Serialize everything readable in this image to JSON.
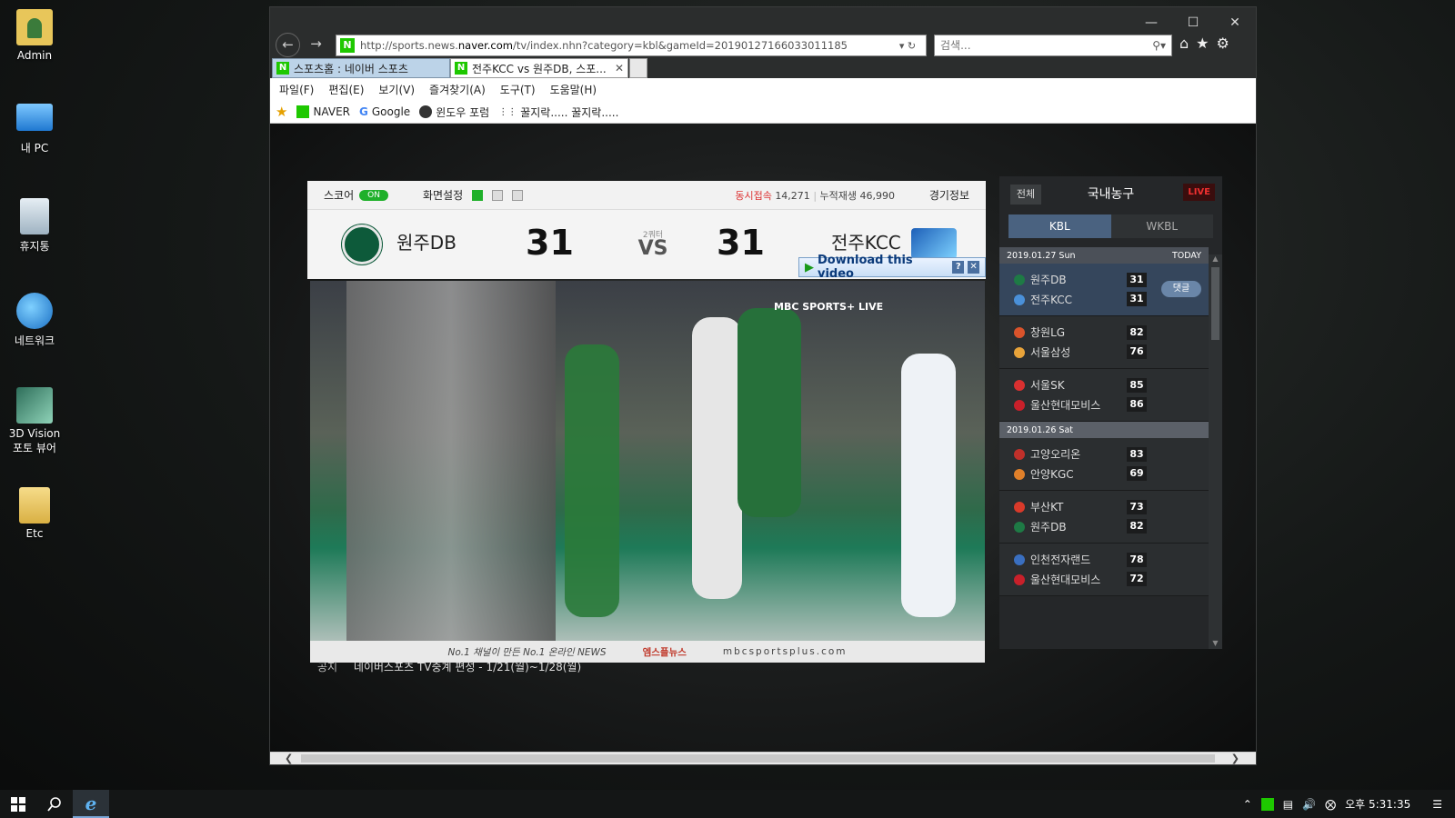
{
  "desktop": {
    "icons": [
      {
        "label": "Admin"
      },
      {
        "label": "내 PC"
      },
      {
        "label": "휴지통"
      },
      {
        "label": "네트워크"
      },
      {
        "label": "3D Vision 포토 뷰어"
      },
      {
        "label": "Etc"
      }
    ]
  },
  "taskbar": {
    "clock": "오후 5:31:35"
  },
  "browser": {
    "url_host_prefix": "http://sports.news.",
    "url_host": "naver.com",
    "url_path": "/tv/index.nhn?category=kbl&gameId=20190127166033011185",
    "search_placeholder": "검색...",
    "tabs": [
      {
        "label": "스포츠홈 : 네이버 스포츠"
      },
      {
        "label": "전주KCC vs 원주DB, 스포..."
      }
    ],
    "menu": [
      "파일(F)",
      "편집(E)",
      "보기(V)",
      "즐겨찾기(A)",
      "도구(T)",
      "도움말(H)"
    ],
    "favorites": [
      "NAVER",
      "Google",
      "윈도우 포럼",
      "꿀지락..... 꿀지락....."
    ]
  },
  "player": {
    "score_label": "스코어",
    "score_toggle": "ON",
    "screen_settings": "화면설정",
    "concurrent_label": "동시접속",
    "concurrent_value": "14,271",
    "cumulative_label": "누적재생",
    "cumulative_value": "46,990",
    "game_info": "경기정보",
    "home_team": "원주DB",
    "home_score": "31",
    "away_team": "전주KCC",
    "away_score": "31",
    "quarter": "2쿼터",
    "vs": "VS",
    "download_label": "Download this video",
    "video_caption_left": "No.1 채널이 만든 No.1 온라인 NEWS",
    "video_caption_brand": "엠스플뉴스",
    "video_caption_right": "mbcsportsplus.com",
    "broadcast_tag": "MBC SPORTS+ LIVE"
  },
  "notice": {
    "label": "공지",
    "text": "네이버스포츠 TV중계 편성 - 1/21(월)~1/28(월)"
  },
  "side": {
    "all_button": "전체",
    "title": "국내농구",
    "live": "LIVE",
    "leagues": [
      "KBL",
      "WKBL"
    ],
    "days": [
      {
        "date": "2019.01.27 Sun",
        "tag": "TODAY"
      },
      {
        "date": "2019.01.26 Sat",
        "tag": ""
      }
    ],
    "games": [
      {
        "t1": "원주DB",
        "s1": "31",
        "t2": "전주KCC",
        "s2": "31",
        "comment": "댓글"
      },
      {
        "t1": "창원LG",
        "s1": "82",
        "t2": "서울삼성",
        "s2": "76"
      },
      {
        "t1": "서울SK",
        "s1": "85",
        "t2": "울산현대모비스",
        "s2": "86"
      },
      {
        "t1": "고양오리온",
        "s1": "83",
        "t2": "안양KGC",
        "s2": "69"
      },
      {
        "t1": "부산KT",
        "s1": "73",
        "t2": "원주DB",
        "s2": "82"
      },
      {
        "t1": "인천전자랜드",
        "s1": "78",
        "t2": "울산현대모비스",
        "s2": "72"
      }
    ]
  }
}
